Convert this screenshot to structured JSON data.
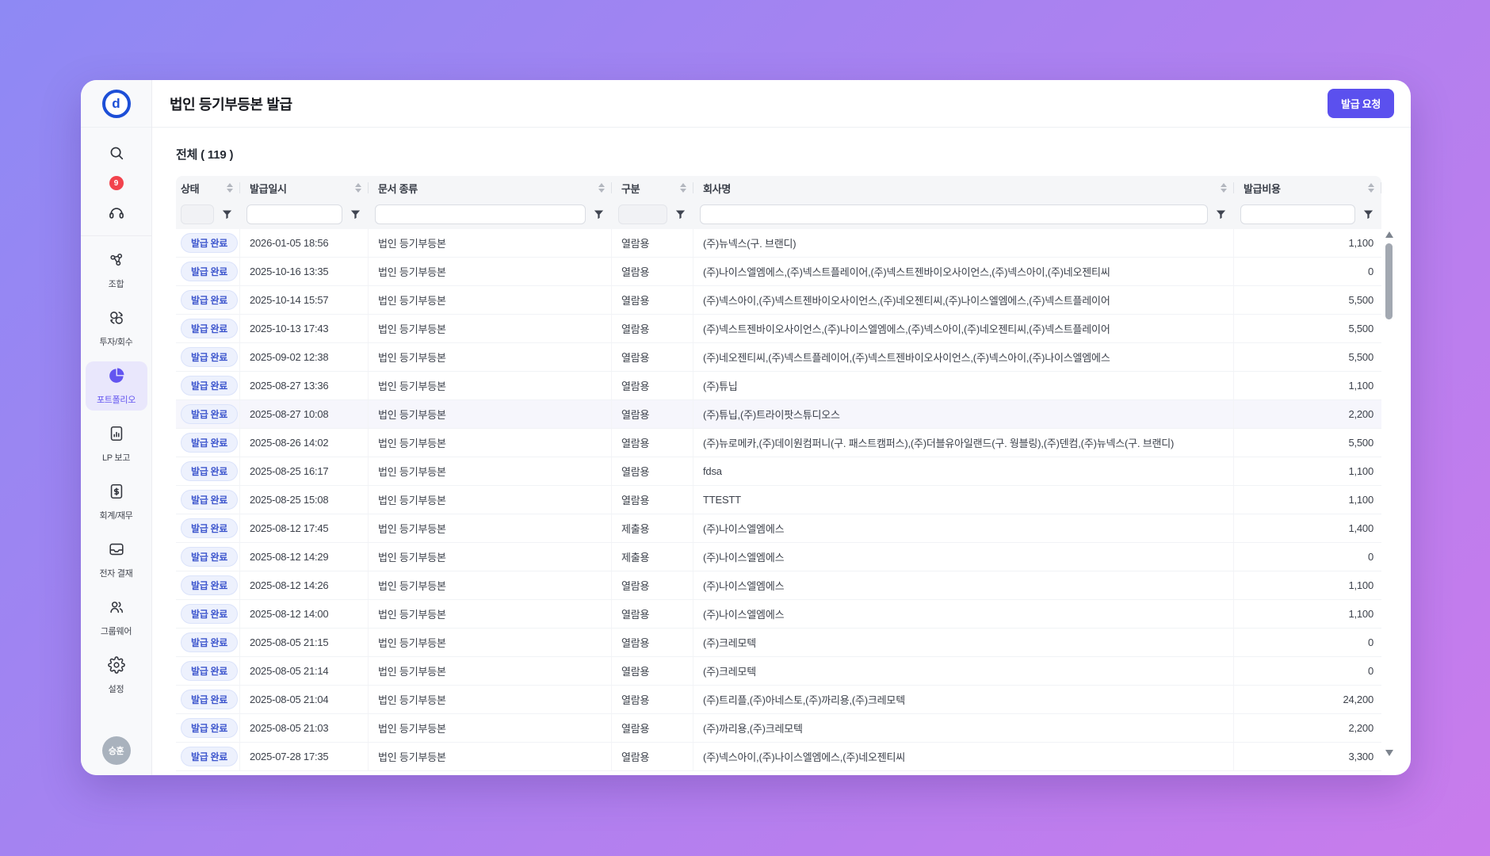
{
  "app": {
    "logo_letter": "d",
    "page_title": "법인 등기부등본 발급",
    "issue_request_button": "발급 요청",
    "total_count_label": "전체 ( 119 )",
    "notification_count": "9",
    "avatar_name": "승훈"
  },
  "colors": {
    "background_gradient_start": "#8e89f4",
    "background_gradient_end": "#c97bec",
    "accent_purple": "#5b50ee",
    "nav_active_bg": "#e9e7fc",
    "nav_active_text": "#6355f0",
    "badge_bg": "#edf1fd",
    "badge_text": "#3c55cd",
    "notification_red": "#f2434d",
    "logo_blue": "#1d4fd7"
  },
  "sidebar": {
    "items": [
      {
        "id": "johap",
        "label": "조합",
        "icon": "network-icon"
      },
      {
        "id": "invest",
        "label": "투자/회수",
        "icon": "cycle-icon"
      },
      {
        "id": "portfolio",
        "label": "포트폴리오",
        "icon": "pie-chart-icon",
        "active": true
      },
      {
        "id": "lp-report",
        "label": "LP 보고",
        "icon": "report-doc-icon"
      },
      {
        "id": "finance",
        "label": "회계/재무",
        "icon": "finance-doc-icon"
      },
      {
        "id": "approval",
        "label": "전자 결재",
        "icon": "inbox-icon"
      },
      {
        "id": "groupware",
        "label": "그룹웨어",
        "icon": "people-icon"
      },
      {
        "id": "settings",
        "label": "설정",
        "icon": "gear-icon"
      }
    ]
  },
  "table": {
    "columns": [
      {
        "key": "status",
        "label": "상태",
        "filter_gray": true
      },
      {
        "key": "date",
        "label": "발급일시",
        "filter_gray": false
      },
      {
        "key": "doc",
        "label": "문서 종류",
        "filter_gray": false
      },
      {
        "key": "type",
        "label": "구분",
        "filter_gray": true
      },
      {
        "key": "company",
        "label": "회사명",
        "filter_gray": false
      },
      {
        "key": "cost",
        "label": "발급비용",
        "filter_gray": false
      }
    ],
    "rows": [
      {
        "status": "발급 완료",
        "date": "2026-01-05 18:56",
        "doc": "법인 등기부등본",
        "type": "열람용",
        "company": "(주)뉴넥스(구. 브랜디)",
        "cost": "1,100"
      },
      {
        "status": "발급 완료",
        "date": "2025-10-16 13:35",
        "doc": "법인 등기부등본",
        "type": "열람용",
        "company": "(주)나이스엘엠에스,(주)넥스트플레이어,(주)넥스트젠바이오사이언스,(주)넥스아이,(주)네오젠티씨",
        "cost": "0"
      },
      {
        "status": "발급 완료",
        "date": "2025-10-14 15:57",
        "doc": "법인 등기부등본",
        "type": "열람용",
        "company": "(주)넥스아이,(주)넥스트젠바이오사이언스,(주)네오젠티씨,(주)나이스엘엠에스,(주)넥스트플레이어",
        "cost": "5,500"
      },
      {
        "status": "발급 완료",
        "date": "2025-10-13 17:43",
        "doc": "법인 등기부등본",
        "type": "열람용",
        "company": "(주)넥스트젠바이오사이언스,(주)나이스엘엠에스,(주)넥스아이,(주)네오젠티씨,(주)넥스트플레이어",
        "cost": "5,500"
      },
      {
        "status": "발급 완료",
        "date": "2025-09-02 12:38",
        "doc": "법인 등기부등본",
        "type": "열람용",
        "company": "(주)네오젠티씨,(주)넥스트플레이어,(주)넥스트젠바이오사이언스,(주)넥스아이,(주)나이스엘엠에스",
        "cost": "5,500"
      },
      {
        "status": "발급 완료",
        "date": "2025-08-27 13:36",
        "doc": "법인 등기부등본",
        "type": "열람용",
        "company": "(주)튜닙",
        "cost": "1,100"
      },
      {
        "status": "발급 완료",
        "date": "2025-08-27 10:08",
        "doc": "법인 등기부등본",
        "type": "열람용",
        "company": "(주)튜닙,(주)트라이팟스튜디오스",
        "cost": "2,200",
        "highlighted": true
      },
      {
        "status": "발급 완료",
        "date": "2025-08-26 14:02",
        "doc": "법인 등기부등본",
        "type": "열람용",
        "company": "(주)뉴로메카,(주)데이원컴퍼니(구. 패스트캠퍼스),(주)더블유아일랜드(구. 웡블링),(주)덴컴,(주)뉴넥스(구. 브랜디)",
        "cost": "5,500"
      },
      {
        "status": "발급 완료",
        "date": "2025-08-25 16:17",
        "doc": "법인 등기부등본",
        "type": "열람용",
        "company": "fdsa",
        "cost": "1,100"
      },
      {
        "status": "발급 완료",
        "date": "2025-08-25 15:08",
        "doc": "법인 등기부등본",
        "type": "열람용",
        "company": "TTESTT",
        "cost": "1,100"
      },
      {
        "status": "발급 완료",
        "date": "2025-08-12 17:45",
        "doc": "법인 등기부등본",
        "type": "제출용",
        "company": "(주)나이스엘엠에스",
        "cost": "1,400"
      },
      {
        "status": "발급 완료",
        "date": "2025-08-12 14:29",
        "doc": "법인 등기부등본",
        "type": "제출용",
        "company": "(주)나이스엘엠에스",
        "cost": "0"
      },
      {
        "status": "발급 완료",
        "date": "2025-08-12 14:26",
        "doc": "법인 등기부등본",
        "type": "열람용",
        "company": "(주)나이스엘엠에스",
        "cost": "1,100"
      },
      {
        "status": "발급 완료",
        "date": "2025-08-12 14:00",
        "doc": "법인 등기부등본",
        "type": "열람용",
        "company": "(주)나이스엘엠에스",
        "cost": "1,100"
      },
      {
        "status": "발급 완료",
        "date": "2025-08-05 21:15",
        "doc": "법인 등기부등본",
        "type": "열람용",
        "company": "(주)크레모텍",
        "cost": "0"
      },
      {
        "status": "발급 완료",
        "date": "2025-08-05 21:14",
        "doc": "법인 등기부등본",
        "type": "열람용",
        "company": "(주)크레모텍",
        "cost": "0"
      },
      {
        "status": "발급 완료",
        "date": "2025-08-05 21:04",
        "doc": "법인 등기부등본",
        "type": "열람용",
        "company": "(주)트리플,(주)아네스토,(주)까리용,(주)크레모텍",
        "cost": "24,200"
      },
      {
        "status": "발급 완료",
        "date": "2025-08-05 21:03",
        "doc": "법인 등기부등본",
        "type": "열람용",
        "company": "(주)까리용,(주)크레모텍",
        "cost": "2,200"
      },
      {
        "status": "발급 완료",
        "date": "2025-07-28 17:35",
        "doc": "법인 등기부등본",
        "type": "열람용",
        "company": "(주)넥스아이,(주)나이스엘엠에스,(주)네오젠티씨",
        "cost": "3,300"
      }
    ]
  }
}
